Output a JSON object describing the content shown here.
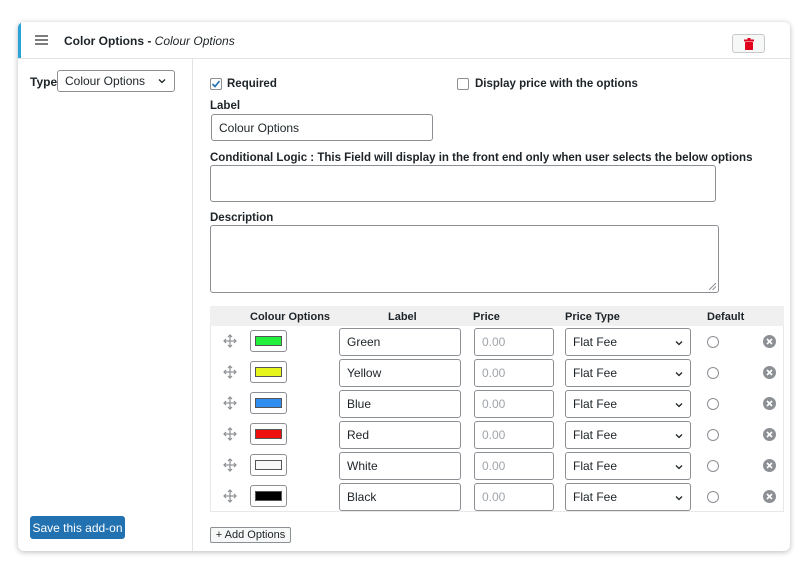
{
  "header": {
    "title": "Color Options",
    "separator": " - ",
    "subtitle": "Colour Options"
  },
  "sidebar": {
    "type_label": "Type",
    "type_value": "Colour Options",
    "save_label": "Save this add-on"
  },
  "form": {
    "required_label": "Required",
    "required_checked": true,
    "display_price_label": "Display price with the options",
    "display_price_checked": false,
    "label_heading": "Label",
    "label_value": "Colour Options",
    "conditional_label": "Conditional Logic : This Field will display in the front end only when user selects the below options",
    "conditional_value": "",
    "description_label": "Description",
    "description_value": ""
  },
  "table": {
    "headers": {
      "colour": "Colour Options",
      "label": "Label",
      "price": "Price",
      "price_type": "Price Type",
      "default": "Default"
    },
    "rows": [
      {
        "color": "#22f03a",
        "label": "Green",
        "price_placeholder": "0.00",
        "price_type": "Flat Fee",
        "default": false
      },
      {
        "color": "#e6f51c",
        "label": "Yellow",
        "price_placeholder": "0.00",
        "price_type": "Flat Fee",
        "default": false
      },
      {
        "color": "#2f8ef0",
        "label": "Blue",
        "price_placeholder": "0.00",
        "price_type": "Flat Fee",
        "default": false
      },
      {
        "color": "#ee0f0f",
        "label": "Red",
        "price_placeholder": "0.00",
        "price_type": "Flat Fee",
        "default": false
      },
      {
        "color": "#f7f7f7",
        "label": "White",
        "price_placeholder": "0.00",
        "price_type": "Flat Fee",
        "default": false
      },
      {
        "color": "#000000",
        "label": "Black",
        "price_placeholder": "0.00",
        "price_type": "Flat Fee",
        "default": false
      }
    ]
  },
  "add_options_label": "+ Add Options",
  "colors": {
    "accent": "#2aa3d9",
    "primary_button": "#2271b1",
    "delete": "#e0001b"
  },
  "icons": {
    "drag": "hamburger-icon",
    "delete": "trash-icon",
    "move": "move-arrows-icon",
    "remove": "close-circle-icon",
    "dropdown": "chevron-down-icon"
  }
}
